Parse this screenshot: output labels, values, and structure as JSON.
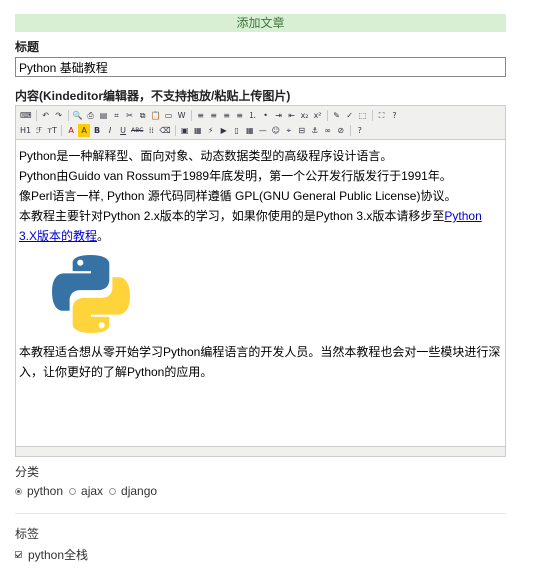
{
  "page": {
    "header": "添加文章"
  },
  "title_field": {
    "label": "标题",
    "value": "Python 基础教程"
  },
  "content_field": {
    "label": "内容(Kindeditor编辑器，不支持拖放/粘贴上传图片)",
    "paragraphs": [
      "Python是一种解释型、面向对象、动态数据类型的高级程序设计语言。",
      "Python由Guido van Rossum于1989年底发明，第一个公开发行版发行于1991年。",
      "像Perl语言一样, Python 源代码同样遵循 GPL(GNU General Public License)协议。"
    ],
    "para4_prefix": "本教程主要针对Python 2.x版本的学习，如果你使用的是Python 3.x版本请移步至",
    "para4_link": "Python 3.X版本的教程",
    "para4_suffix": "。",
    "image_alt": "python-logo",
    "closing": "本教程适合想从零开始学习Python编程语言的开发人员。当然本教程也会对一些模块进行深入，让你更好的了解Python的应用。"
  },
  "toolbar": {
    "row1": [
      "source-icon",
      "undo-icon",
      "redo-icon",
      "preview-icon",
      "print-icon",
      "template-icon",
      "code-icon",
      "cut-icon",
      "copy-icon",
      "paste-icon",
      "paste-plain-icon",
      "paste-word-icon",
      "align-left-icon",
      "align-center-icon",
      "align-right-icon",
      "justify-icon",
      "ordered-list-icon",
      "unordered-list-icon",
      "indent-icon",
      "outdent-icon",
      "subscript-icon",
      "superscript-icon",
      "clear-format-icon",
      "spellcheck-icon",
      "select-all-icon",
      "fullscreen-icon",
      "about-icon"
    ],
    "row2_labels": {
      "heading": "H1",
      "font": "ℱ",
      "size": "тT",
      "forecolor": "A",
      "hilite": "A",
      "bold": "B",
      "italic": "I",
      "underline": "U",
      "strike": "ABC",
      "lineheight": "⁞⁞",
      "removeformat": "⌫"
    },
    "row2_icons": [
      "image-icon",
      "multi-image-icon",
      "flash-icon",
      "media-icon",
      "insert-file-icon",
      "table-icon",
      "hr-icon",
      "emoticon-icon",
      "baidumap-icon",
      "pagebreak-icon",
      "anchor-icon",
      "link-icon",
      "unlink-icon",
      "help-icon"
    ]
  },
  "category": {
    "label": "分类",
    "options": [
      {
        "label": "python",
        "checked": true
      },
      {
        "label": "ajax",
        "checked": false
      },
      {
        "label": "django",
        "checked": false
      }
    ]
  },
  "tags": {
    "label": "标签",
    "options": [
      {
        "label": "python全栈",
        "checked": true
      }
    ]
  },
  "colors": {
    "header_bg": "#d8efd3",
    "link": "#0000cc",
    "python_blue": "#3772a4",
    "python_yellow": "#ffd43b"
  }
}
